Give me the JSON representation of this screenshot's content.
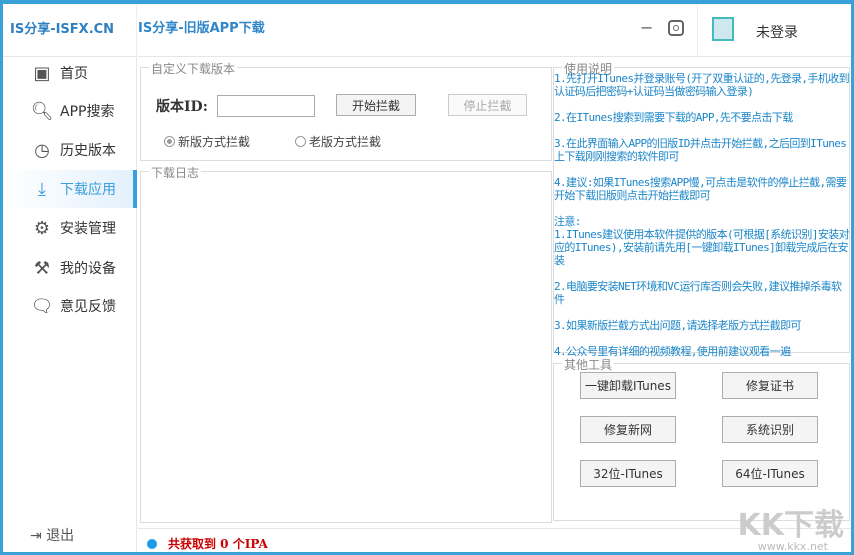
{
  "header": {
    "brand": "IS分享-ISFX.CN",
    "title": "IS分享-旧版APP下载",
    "minimize": "−",
    "login": "未登录"
  },
  "sidebar": {
    "items": [
      {
        "label": "首页",
        "icon": "home-icon",
        "glyph": "▣"
      },
      {
        "label": "APP搜索",
        "icon": "search-icon",
        "glyph": "🔍︎"
      },
      {
        "label": "历史版本",
        "icon": "clock-icon",
        "glyph": "◷"
      },
      {
        "label": "下载应用",
        "icon": "download-icon",
        "glyph": "⤓",
        "active": true
      },
      {
        "label": "安装管理",
        "icon": "install-icon",
        "glyph": "⚙"
      },
      {
        "label": "我的设备",
        "icon": "tools-icon",
        "glyph": "⚒"
      },
      {
        "label": "意见反馈",
        "icon": "feedback-icon",
        "glyph": "🗨"
      }
    ],
    "logout": "退出"
  },
  "custom": {
    "caption": "自定义下载版本",
    "id_label": "版本ID:",
    "id_value": "",
    "start": "开始拦截",
    "stop": "停止拦截",
    "radio_new": "新版方式拦截",
    "radio_old": "老版方式拦截",
    "selected": "new"
  },
  "log": {
    "caption": "下载日志"
  },
  "help": {
    "caption": "使用说明",
    "items": [
      "1.先打开ITunes并登录账号(开了双重认证的,先登录,手机收到认证码后把密码+认证码当做密码输入登录)",
      "2.在ITunes搜索到需要下载的APP,先不要点击下载",
      "3.在此界面输入APP的旧版ID并点击开始拦截,之后回到ITunes上下载刚刚搜索的软件即可",
      "4.建议:如果ITunes搜索APP慢,可点击是软件的停止拦截,需要开始下载旧版则点击开始拦截即可",
      "注意:\n1.ITunes建议使用本软件提供的版本(可根据[系统识别]安装对应的ITunes),安装前请先用[一键卸载ITunes]卸载完成后在安装",
      "2.电脑要安装NET环境和VC运行库否则会失败,建议推掉杀毒软件",
      "3.如果新版拦截方式出问题,请选择老版方式拦截即可",
      "4.公众号里有详细的视频教程,使用前建议观看一遍"
    ]
  },
  "tools": {
    "caption": "其他工具",
    "buttons": [
      "一键卸载ITunes",
      "修复证书",
      "修复新网",
      "系统识别",
      "32位-ITunes",
      "64位-ITunes"
    ]
  },
  "status": {
    "text": "共获取到 0 个IPA"
  },
  "watermark": {
    "logo": "KK下载",
    "url": "www.kkx.net"
  }
}
